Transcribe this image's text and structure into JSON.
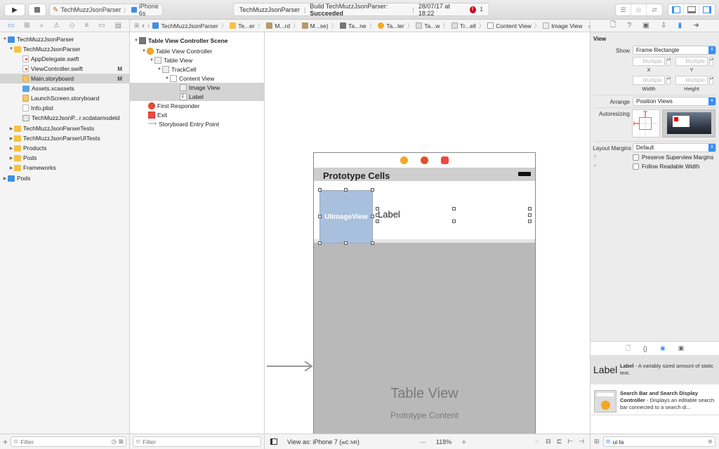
{
  "toolbar": {
    "run_icon": "play-icon",
    "stop_icon": "stop-icon",
    "scheme": "TechMuzzJsonParser",
    "device": "iPhone 6s",
    "activity_project": "TechMuzzJsonParser",
    "activity_build_prefix": "Build TechMuzzJsonParser:",
    "activity_build_status": "Succeeded",
    "activity_time": "28/07/17 at 18:22",
    "error_count": "1"
  },
  "jumpbar": {
    "crumbs": [
      "TechMuzzJsonParser",
      "Te...er",
      "M...rd",
      "M...se)",
      "Ta...ne",
      "Ta...ler",
      "Ta...w",
      "Tr...ell",
      "Content View",
      "Image View"
    ],
    "error_count": "!"
  },
  "navigator": {
    "items": [
      {
        "label": "TechMuzzJsonParser",
        "type": "project",
        "expanded": true
      },
      {
        "label": "TechMuzzJsonParser",
        "type": "folder",
        "expanded": true
      },
      {
        "label": "AppDelegate.swift",
        "type": "swift",
        "badge": ""
      },
      {
        "label": "ViewController.swift",
        "type": "swift",
        "badge": "M"
      },
      {
        "label": "Main.storyboard",
        "type": "storyboard",
        "badge": "M",
        "selected": true
      },
      {
        "label": "Assets.xcassets",
        "type": "assets",
        "badge": ""
      },
      {
        "label": "LaunchScreen.storyboard",
        "type": "storyboard",
        "badge": ""
      },
      {
        "label": "Info.plist",
        "type": "plist",
        "badge": ""
      },
      {
        "label": "TechMuzzJsonP...r.xcdatamodeld",
        "type": "model",
        "badge": ""
      },
      {
        "label": "TechMuzzJsonParserTests",
        "type": "folder"
      },
      {
        "label": "TechMuzzJsonParserUITests",
        "type": "folder"
      },
      {
        "label": "Products",
        "type": "folder"
      },
      {
        "label": "Pods",
        "type": "folder"
      },
      {
        "label": "Frameworks",
        "type": "folder"
      },
      {
        "label": "Pods",
        "type": "project"
      }
    ],
    "filter_placeholder": "Filter"
  },
  "outline": {
    "items": [
      {
        "label": "Table View Controller Scene",
        "bold": true
      },
      {
        "label": "Table View Controller"
      },
      {
        "label": "Table View"
      },
      {
        "label": "TrackCell"
      },
      {
        "label": "Content View"
      },
      {
        "label": "Image View",
        "selected": true
      },
      {
        "label": "Label",
        "selected": true
      },
      {
        "label": "First Responder"
      },
      {
        "label": "Exit"
      },
      {
        "label": "Storyboard Entry Point"
      }
    ],
    "filter_placeholder": "Filter"
  },
  "canvas": {
    "header_title": "Prototype Cells",
    "image_view_label": "UIImageView",
    "label_text": "Label",
    "table_view_title": "Table View",
    "table_view_subtitle": "Prototype Content",
    "view_as": "View as: iPhone 7 (",
    "size_class": "wC hR",
    "view_as_close": ")",
    "zoom": "118%",
    "zoom_out": "—",
    "zoom_in": "+"
  },
  "inspector": {
    "section_title": "View",
    "show_label": "Show",
    "show_value": "Frame Rectangle",
    "x_value": "Multiple",
    "y_value": "Multiple",
    "width_value": "Multiple",
    "height_value": "Multiple",
    "x_label": "X",
    "y_label": "Y",
    "width_label": "Width",
    "height_label": "Height",
    "arrange_label": "Arrange",
    "arrange_value": "Position Views",
    "autoresizing_label": "Autoresizing",
    "layout_margins_label": "Layout Margins",
    "layout_margins_value": "Default",
    "preserve_label": "Preserve Superview Margins",
    "readable_label": "Follow Readable Width"
  },
  "library": {
    "items": [
      {
        "icon_text": "Label",
        "title": "Label",
        "description": " - A variably sized amount of static text."
      },
      {
        "title": "Search Bar and Search Display Controller",
        "description": " - Displays an editable search bar connected to a search di..."
      }
    ],
    "search_value": "ui la"
  }
}
